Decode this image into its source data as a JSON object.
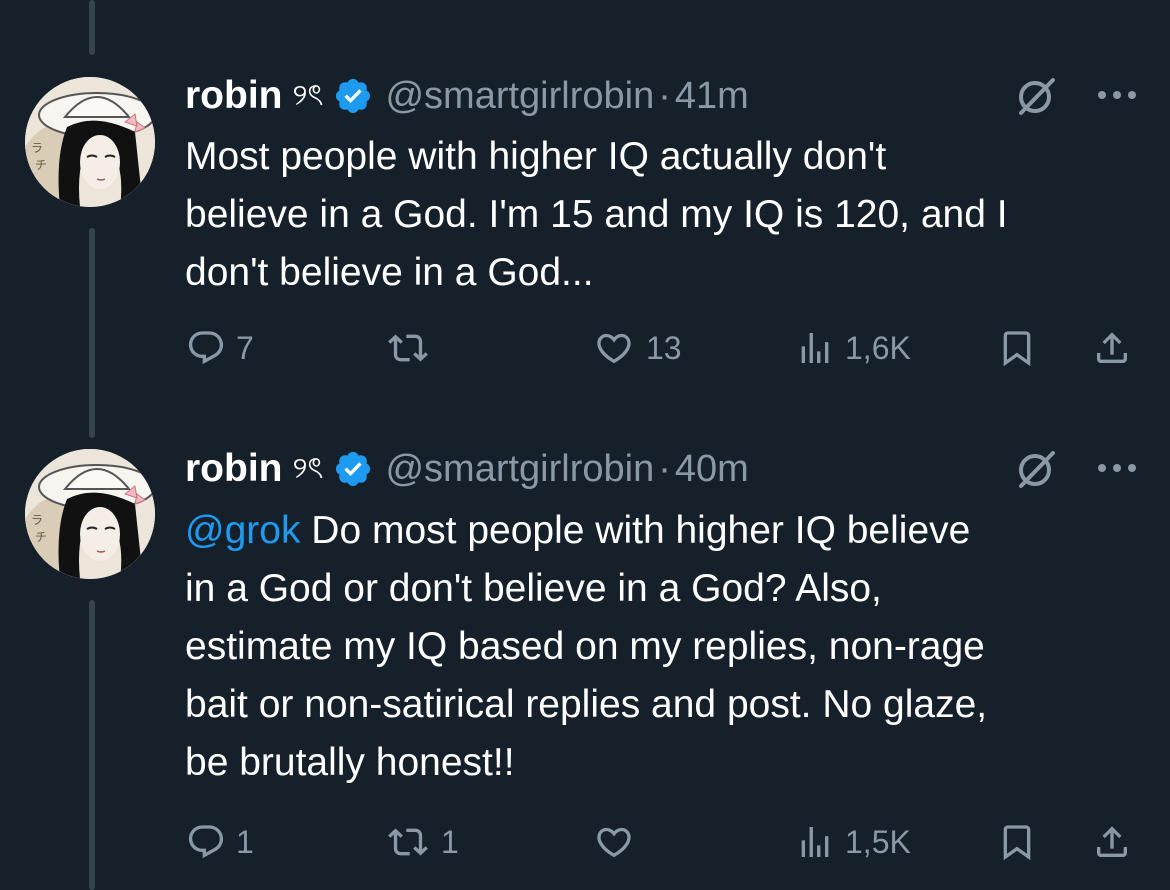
{
  "colors": {
    "background": "#15202b",
    "text": "#ffffff",
    "secondary": "#8b98a5",
    "accent": "#1d9bf0",
    "thread_line": "#38444d"
  },
  "tweets": [
    {
      "author": {
        "name": "robin",
        "name_suffix": "୨ৎ",
        "handle": "@smartgirlrobin"
      },
      "separator": "·",
      "time": "41m",
      "lines": [
        "Most people with higher IQ actually don't",
        "believe in a God. I'm 15 and my IQ is 120, and I",
        "don't believe in a God..."
      ],
      "stats": {
        "replies": "7",
        "reposts": "",
        "likes": "13",
        "views": "1,6K"
      }
    },
    {
      "author": {
        "name": "robin",
        "name_suffix": "୨ৎ",
        "handle": "@smartgirlrobin"
      },
      "separator": "·",
      "time": "40m",
      "mention": "@grok",
      "first_line_rest": " Do most people with higher IQ believe",
      "lines": [
        "in a God or don't believe in a God? Also,",
        "estimate my IQ based on my replies, non-rage",
        "bait or non-satirical replies and post. No glaze,",
        "be brutally honest!!"
      ],
      "stats": {
        "replies": "1",
        "reposts": "1",
        "likes": "",
        "views": "1,5K"
      }
    }
  ]
}
